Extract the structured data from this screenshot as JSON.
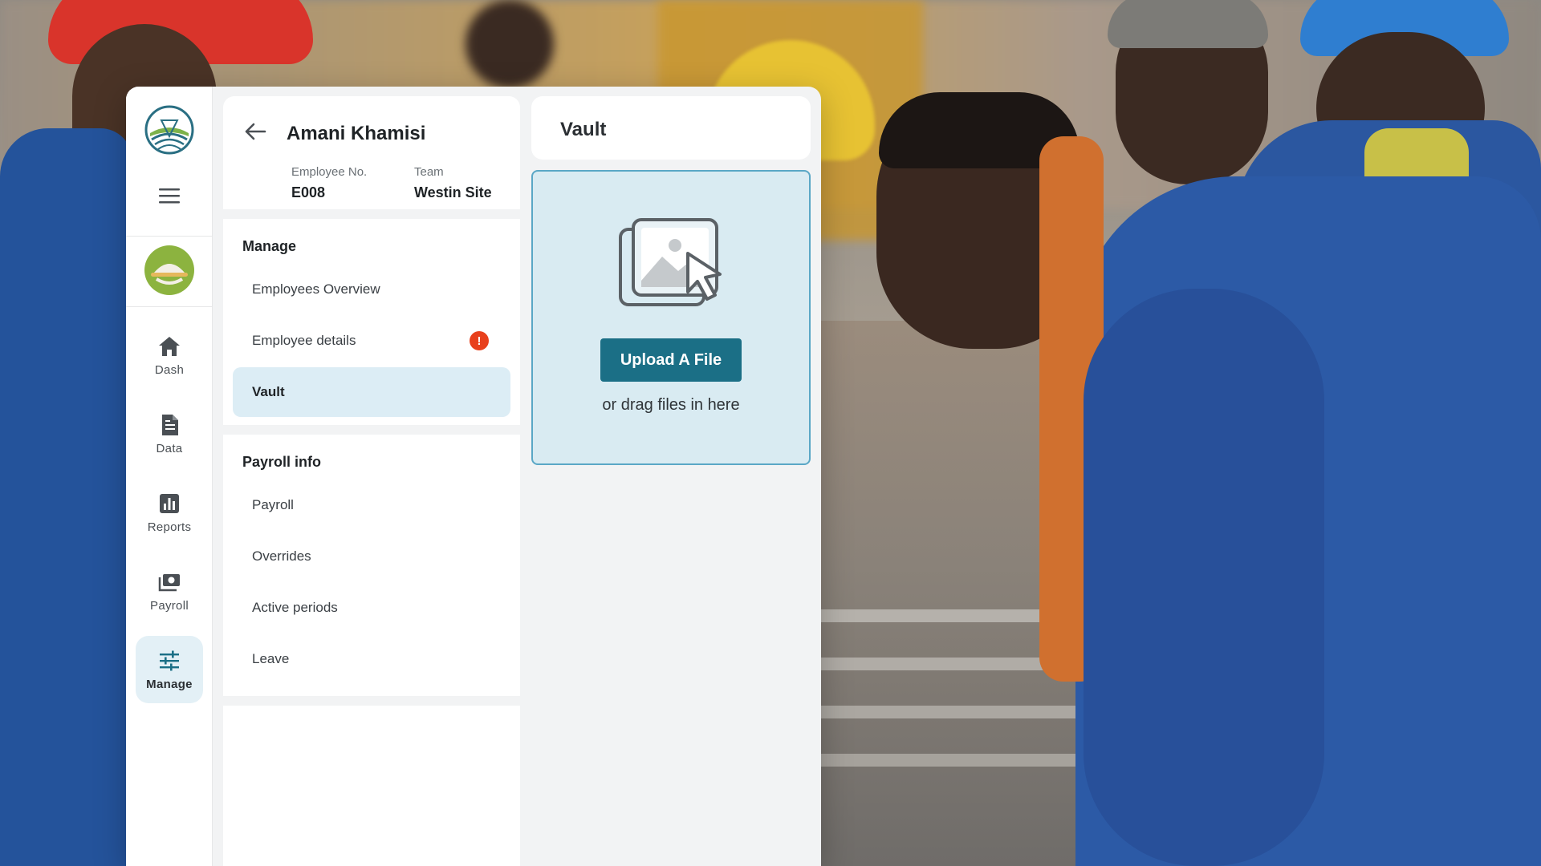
{
  "nav": {
    "items": [
      {
        "id": "dash",
        "label": "Dash",
        "icon": "home-icon"
      },
      {
        "id": "data",
        "label": "Data",
        "icon": "document-icon"
      },
      {
        "id": "reports",
        "label": "Reports",
        "icon": "bar-chart-icon"
      },
      {
        "id": "payroll",
        "label": "Payroll",
        "icon": "cash-icon"
      },
      {
        "id": "manage",
        "label": "Manage",
        "icon": "sliders-icon",
        "active": true
      }
    ]
  },
  "employee": {
    "name": "Amani Khamisi",
    "number_label": "Employee No.",
    "number": "E008",
    "team_label": "Team",
    "team": "Westin Site"
  },
  "manage": {
    "title": "Manage",
    "items": [
      {
        "label": "Employees Overview"
      },
      {
        "label": "Employee details",
        "alert": "!"
      },
      {
        "label": "Vault",
        "selected": true
      }
    ]
  },
  "payroll_info": {
    "title": "Payroll info",
    "items": [
      {
        "label": "Payroll"
      },
      {
        "label": "Overrides"
      },
      {
        "label": "Active periods"
      },
      {
        "label": "Leave"
      }
    ]
  },
  "vault": {
    "title": "Vault",
    "upload_label": "Upload A File",
    "drag_hint": "or drag files in here"
  },
  "colors": {
    "accent": "#1b6f86",
    "dropzone_bg": "#d9ebf2",
    "dropzone_border": "#5aa7c6",
    "selected_bg": "#dcedf5",
    "alert": "#e8401c"
  }
}
